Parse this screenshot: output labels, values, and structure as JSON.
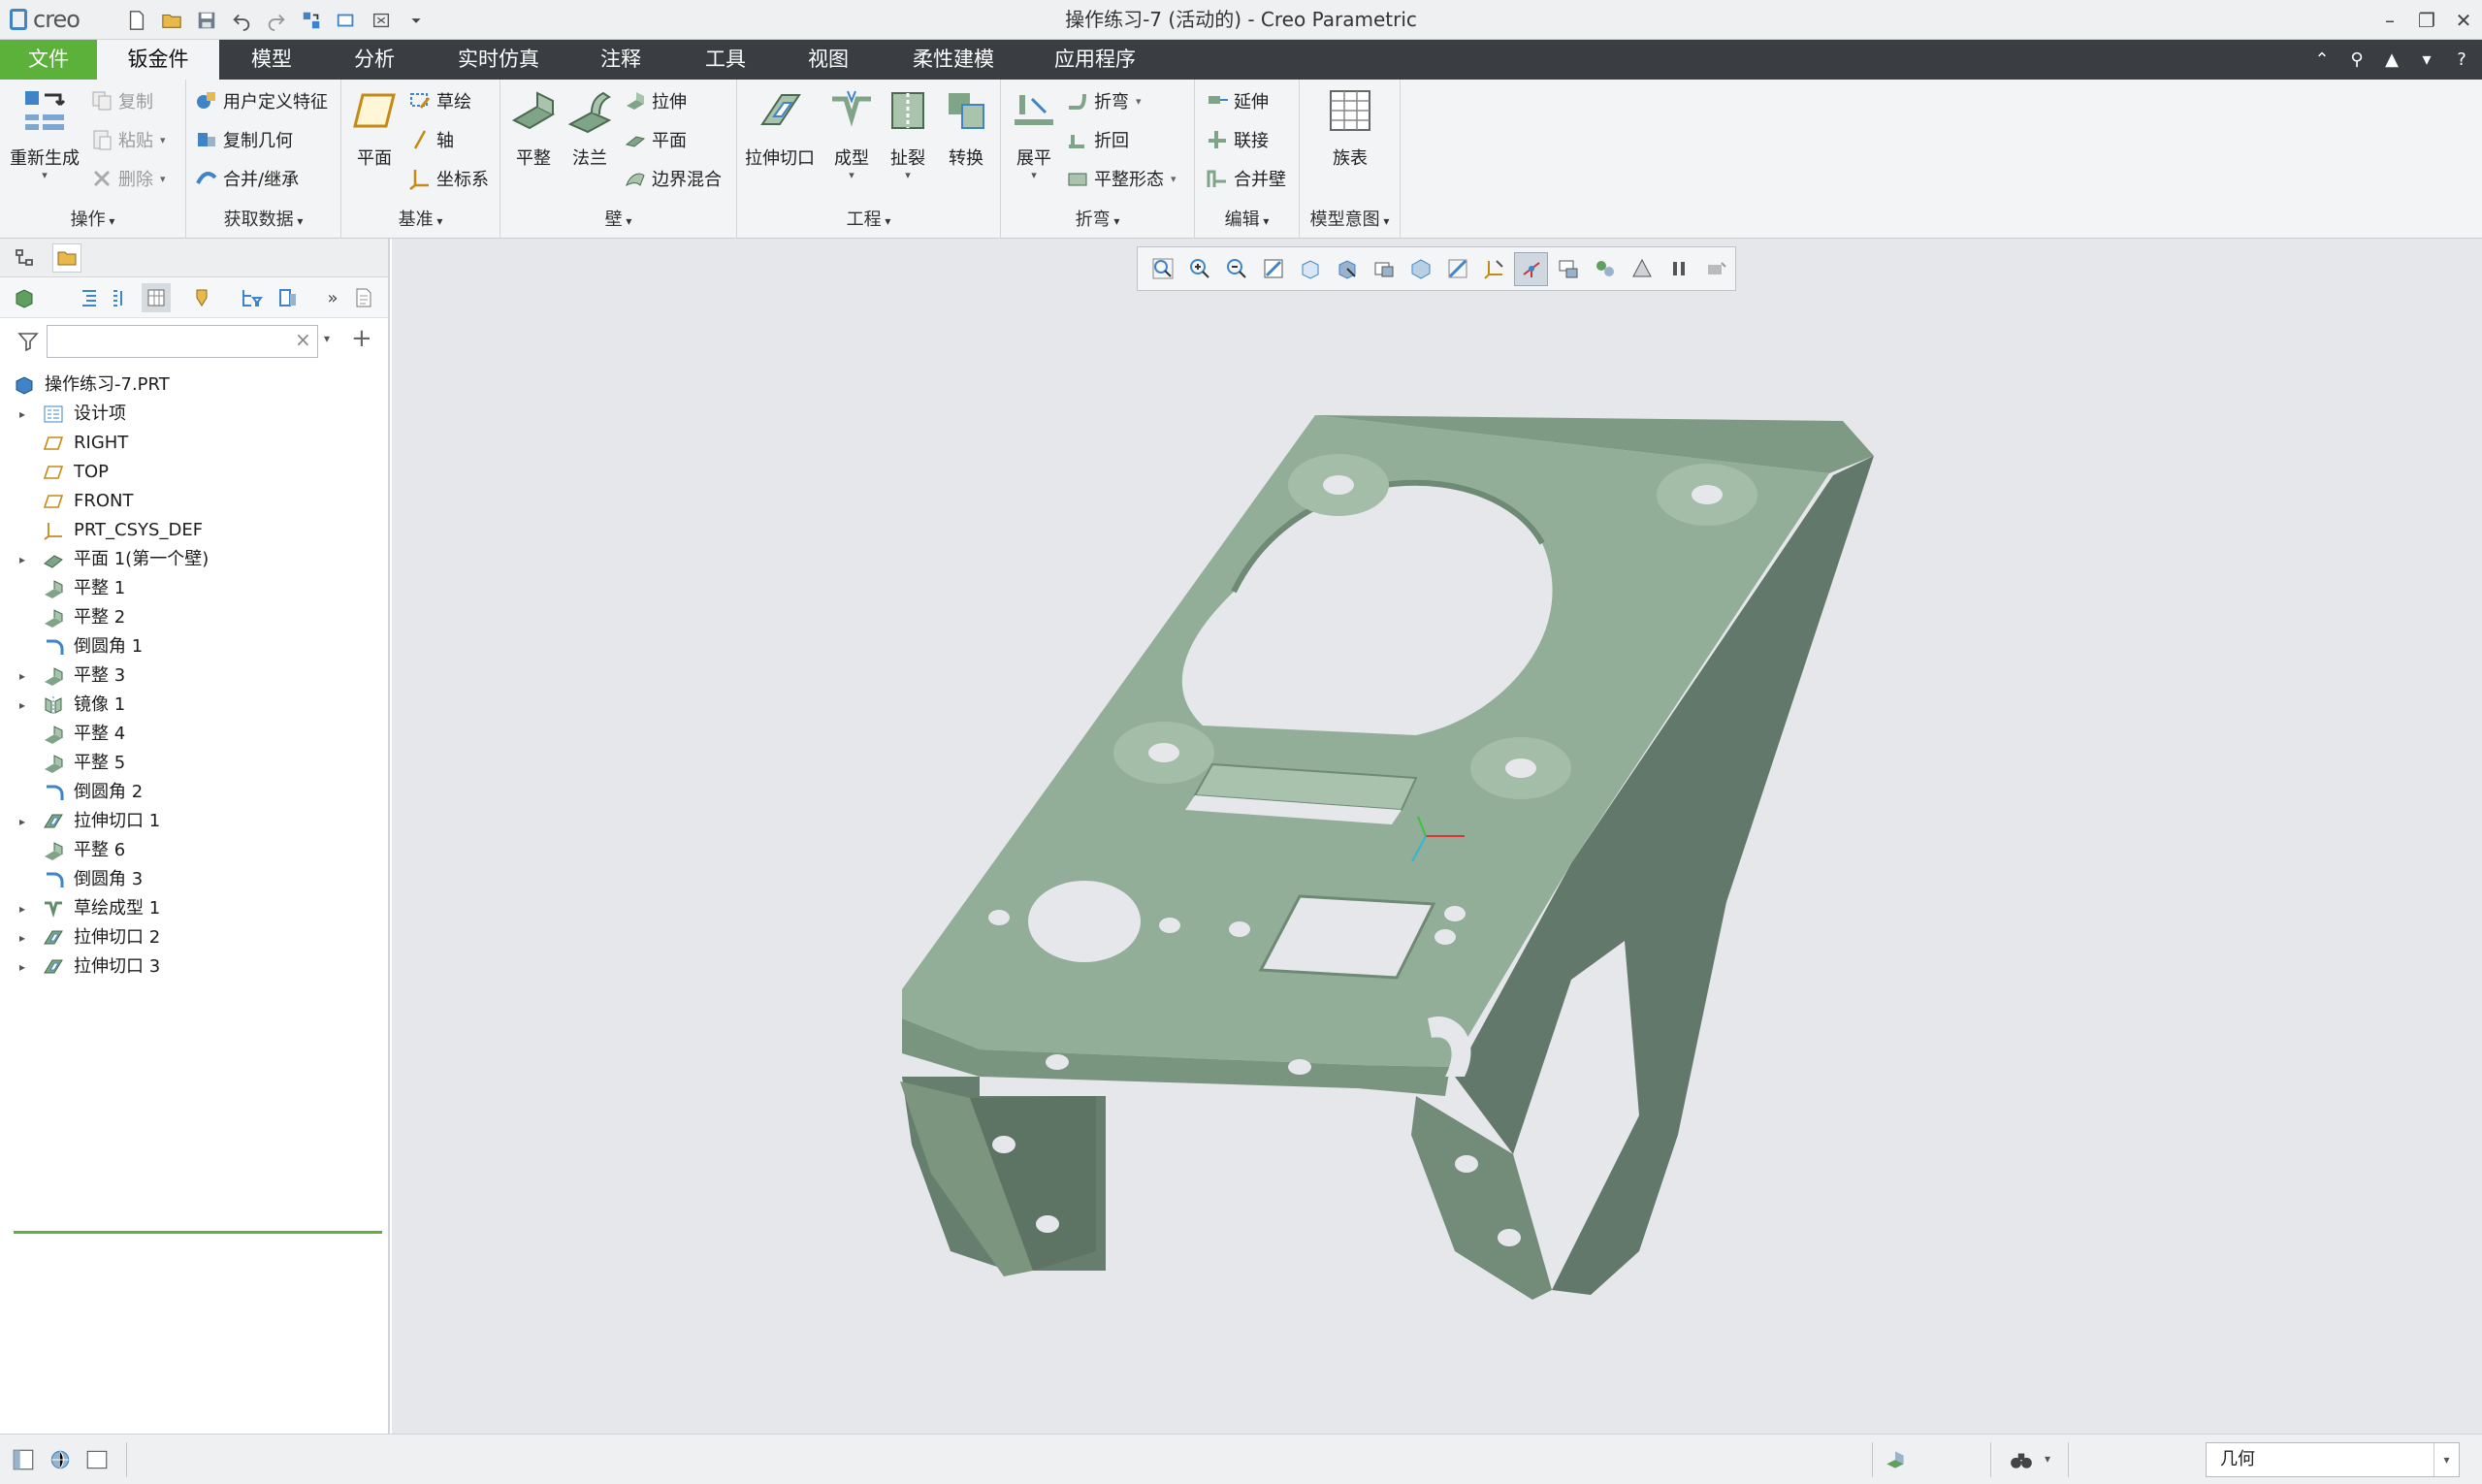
{
  "app": {
    "brand": "creo",
    "window_title": "操作练习-7 (活动的) - Creo Parametric",
    "accent_color": "#5bb13a",
    "menubar_color": "#3a3e43"
  },
  "menu_tabs": [
    {
      "label": "文件"
    },
    {
      "label": "钣金件"
    },
    {
      "label": "模型"
    },
    {
      "label": "分析"
    },
    {
      "label": "实时仿真"
    },
    {
      "label": "注释"
    },
    {
      "label": "工具"
    },
    {
      "label": "视图"
    },
    {
      "label": "柔性建模"
    },
    {
      "label": "应用程序"
    }
  ],
  "ribbon": {
    "operations": {
      "label": "操作",
      "regenerate": "重新生成",
      "copy": "复制",
      "paste": "粘贴",
      "delete": "删除"
    },
    "get_data": {
      "label": "获取数据",
      "udf": "用户定义特征",
      "copy_geom": "复制几何",
      "merge": "合并/继承"
    },
    "datum": {
      "label": "基准",
      "plane": "平面",
      "sketch": "草绘",
      "axis": "轴",
      "csys": "坐标系"
    },
    "wall": {
      "label": "壁",
      "flat": "平整",
      "flange": "法兰",
      "extrude": "拉伸",
      "planar": "平面",
      "boundary_blend": "边界混合"
    },
    "engineering": {
      "label": "工程",
      "extrude_cut": "拉伸切口",
      "form": "成型",
      "rip": "扯裂",
      "convert": "转换"
    },
    "bends": {
      "label": "折弯",
      "unbend": "展平",
      "bend": "折弯",
      "bend_back": "折回",
      "flat_state": "平整形态"
    },
    "editing": {
      "label": "编辑",
      "extend": "延伸",
      "join": "联接",
      "merge_walls": "合并壁"
    },
    "model_intent": {
      "label": "模型意图",
      "family_table": "族表"
    }
  },
  "model_tree": {
    "search_value": "",
    "items": [
      {
        "label": "操作练习-7.PRT",
        "icon": "part-icon",
        "expandable": false
      },
      {
        "label": "设计项",
        "icon": "design-items-icon",
        "expandable": true
      },
      {
        "label": "RIGHT",
        "icon": "datum-plane-icon",
        "expandable": false
      },
      {
        "label": "TOP",
        "icon": "datum-plane-icon",
        "expandable": false
      },
      {
        "label": "FRONT",
        "icon": "datum-plane-icon",
        "expandable": false
      },
      {
        "label": "PRT_CSYS_DEF",
        "icon": "csys-icon",
        "expandable": false
      },
      {
        "label": "平面 1(第一个壁)",
        "icon": "flat-wall-icon",
        "expandable": true
      },
      {
        "label": "平整 1",
        "icon": "flat-wall-icon",
        "expandable": false
      },
      {
        "label": "平整 2",
        "icon": "flat-wall-icon",
        "expandable": false
      },
      {
        "label": "倒圆角 1",
        "icon": "round-icon",
        "expandable": false
      },
      {
        "label": "平整 3",
        "icon": "flat-wall-icon",
        "expandable": true
      },
      {
        "label": "镜像 1",
        "icon": "mirror-icon",
        "expandable": true
      },
      {
        "label": "平整 4",
        "icon": "flat-wall-icon",
        "expandable": false
      },
      {
        "label": "平整 5",
        "icon": "flat-wall-icon",
        "expandable": false
      },
      {
        "label": "倒圆角 2",
        "icon": "round-icon",
        "expandable": false
      },
      {
        "label": "拉伸切口 1",
        "icon": "extrude-cut-icon",
        "expandable": true
      },
      {
        "label": "平整 6",
        "icon": "flat-wall-icon",
        "expandable": false
      },
      {
        "label": "倒圆角 3",
        "icon": "round-icon",
        "expandable": false
      },
      {
        "label": "草绘成型 1",
        "icon": "sketch-form-icon",
        "expandable": true
      },
      {
        "label": "拉伸切口 2",
        "icon": "extrude-cut-icon",
        "expandable": true
      },
      {
        "label": "拉伸切口 3",
        "icon": "extrude-cut-icon",
        "expandable": true
      }
    ]
  },
  "status_bar": {
    "selection_filter": "几何"
  }
}
